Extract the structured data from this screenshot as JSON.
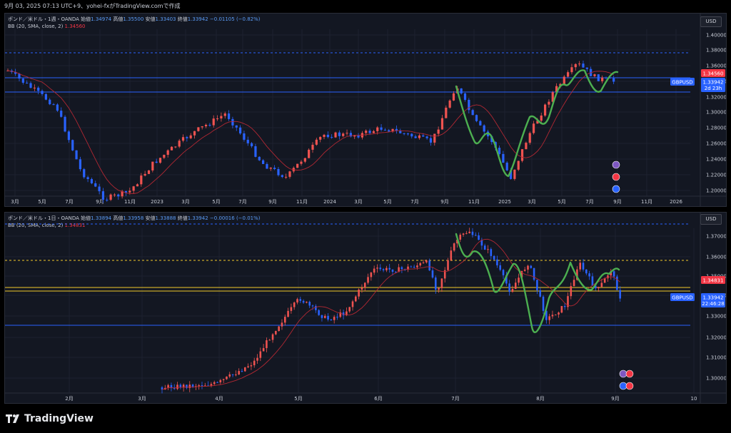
{
  "header": {
    "text": "9月 03, 2025 07:13 UTC+9、yohei-fxがTradingView.comで作成"
  },
  "pane1": {
    "title": "ポンド／米ドル・1週・OANDA",
    "o_label": "始値",
    "o": "1.34974",
    "h_label": "高値",
    "h": "1.35500",
    "l_label": "安値",
    "l": "1.33403",
    "c_label": "終値",
    "c": "1.33942",
    "chg": "−0.01105 (−0.82%)",
    "bb_label": "BB (20, SMA, close, 2)",
    "bb_value": "1.34560",
    "currency": "USD",
    "price_labels": [
      "1.40000",
      "1.38000",
      "1.36000",
      "1.34000",
      "1.32000",
      "1.30000",
      "1.28000",
      "1.26000",
      "1.24000",
      "1.22000",
      "1.20000"
    ],
    "bb_tag": "1.34560",
    "symbol_tag": "GBPUSD",
    "last_price": "1.33942",
    "countdown": "2d 23h",
    "time_labels": [
      "3月",
      "5月",
      "7月",
      "9月",
      "11月",
      "2023",
      "3月",
      "5月",
      "7月",
      "9月",
      "11月",
      "2024",
      "3月",
      "5月",
      "7月",
      "9月",
      "11月",
      "2025",
      "3月",
      "5月",
      "7月",
      "9月",
      "11月",
      "2026"
    ]
  },
  "pane2": {
    "title": "ポンド／米ドル・1日・OANDA",
    "o_label": "始値",
    "o": "1.33894",
    "h_label": "高値",
    "h": "1.33958",
    "l_label": "安値",
    "l": "1.33888",
    "c_label": "終値",
    "c": "1.33942",
    "chg": "−0.00016 (−0.01%)",
    "bb_label": "BB (20, SMA, close, 2)",
    "bb_value": "1.34831",
    "currency": "USD",
    "price_labels": [
      "1.37000",
      "1.36000",
      "1.35000",
      "1.34000",
      "1.33000",
      "1.32000",
      "1.31000",
      "1.30000"
    ],
    "bb_tag": "1.34831",
    "symbol_tag": "GBPUSD",
    "last_price": "1.33942",
    "countdown": "22:46:28",
    "time_labels": [
      "2月",
      "3月",
      "4月",
      "5月",
      "6月",
      "7月",
      "8月",
      "9月",
      "10"
    ]
  },
  "footer": {
    "brand": "TradingView"
  },
  "colors": {
    "bull": "#ef5350",
    "bear": "#2962ff",
    "bb": "#b22833",
    "hline": "#2962ff",
    "green": "#4caf50",
    "bg": "#131722"
  }
}
